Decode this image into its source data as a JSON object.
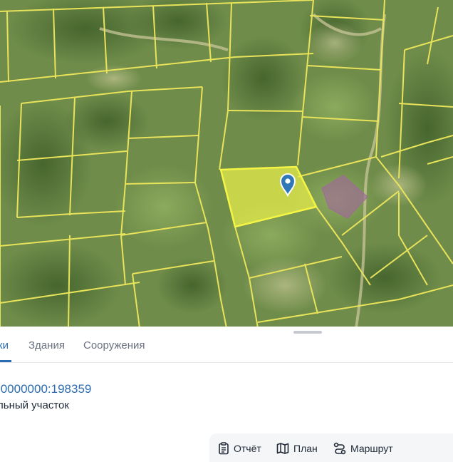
{
  "map": {
    "colors": {
      "terrain": "#6f8c4a",
      "boundary": "#e8e35a",
      "selected_fill": "#eef24a",
      "neighbor_fill": "#a06a9a",
      "marker": "#2f78b7"
    },
    "marker_icon": "map-pin-icon"
  },
  "tabs": [
    {
      "label": "ки",
      "active": true
    },
    {
      "label": "Здания",
      "active": false
    },
    {
      "label": "Сооружения",
      "active": false
    }
  ],
  "parcel": {
    "cadastral_number": ":0000000:198359",
    "type": "льный участок"
  },
  "actions": [
    {
      "label": "Отчёт",
      "icon": "report-icon"
    },
    {
      "label": "План",
      "icon": "plan-map-icon"
    },
    {
      "label": "Маршрут",
      "icon": "route-icon"
    }
  ]
}
